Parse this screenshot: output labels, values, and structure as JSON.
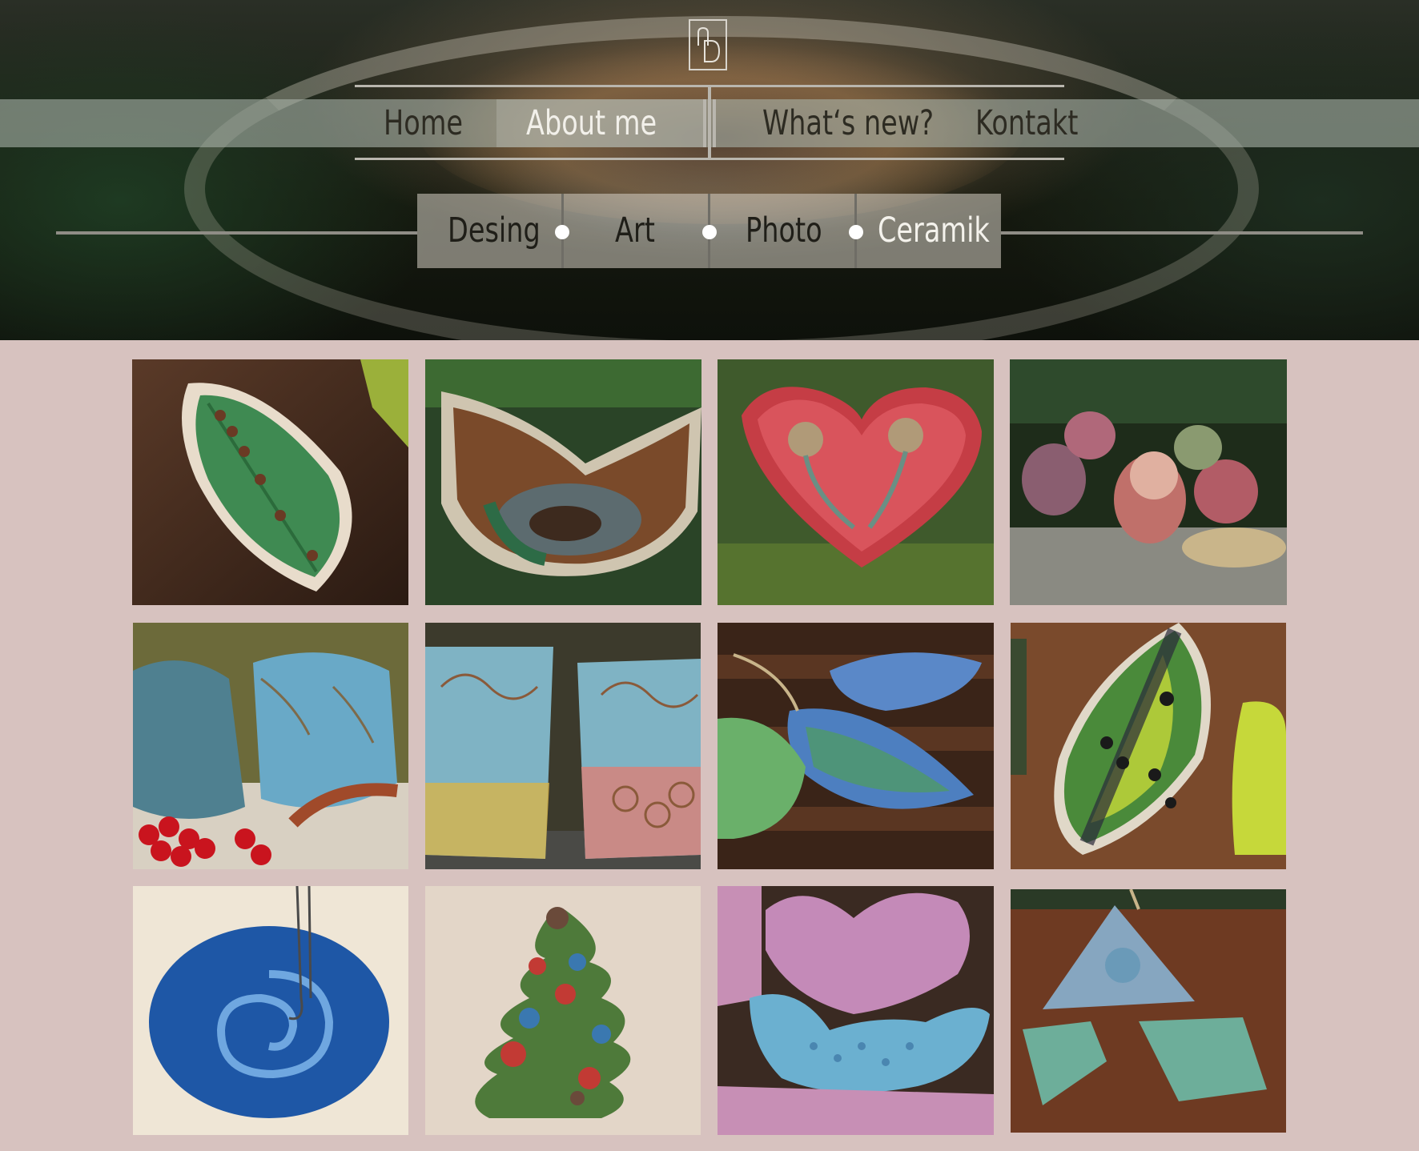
{
  "logo": {
    "monogram": "nD"
  },
  "nav": {
    "items": [
      {
        "label": "Home",
        "active": false
      },
      {
        "label": "About me",
        "active": true
      },
      {
        "label": "What‘s new?",
        "active": false
      },
      {
        "label": "Kontakt",
        "active": false
      }
    ]
  },
  "subnav": {
    "items": [
      {
        "label": "Desing",
        "active": false
      },
      {
        "label": "Art",
        "active": false
      },
      {
        "label": "Photo",
        "active": false
      },
      {
        "label": "Ceramik",
        "active": true
      }
    ]
  },
  "gallery": {
    "items": [
      {
        "subject": "green leaf dish"
      },
      {
        "subject": "brown glazed bowl"
      },
      {
        "subject": "red heart dish"
      },
      {
        "subject": "ceramic beads"
      },
      {
        "subject": "blue cups with berries"
      },
      {
        "subject": "two painted cups"
      },
      {
        "subject": "blue leaf pendants"
      },
      {
        "subject": "green leaf pendant"
      },
      {
        "subject": "blue spiral dish"
      },
      {
        "subject": "christmas tree ornament"
      },
      {
        "subject": "heart and bird ornaments"
      },
      {
        "subject": "triangle and diamond pendants"
      }
    ]
  },
  "colors": {
    "page_background": "#d7c2bf",
    "nav_text": "#2d2b22",
    "active_text": "#f2f0ea"
  }
}
